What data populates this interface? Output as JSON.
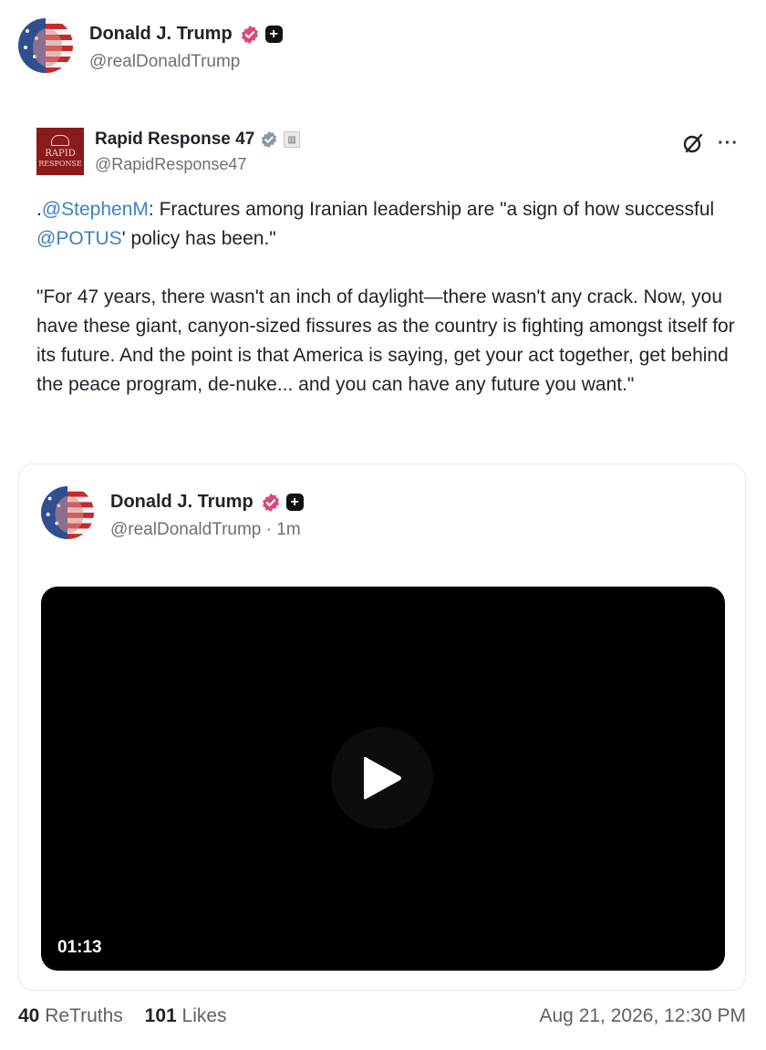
{
  "author": {
    "name": "Donald J. Trump",
    "handle": "@realDonaldTrump"
  },
  "retruth": {
    "name": "Rapid Response 47",
    "handle": "@RapidResponse47",
    "logo_text_1": "RAPID",
    "logo_text_2": "RESPONSE",
    "text_parts": {
      "p1_prefix": ".",
      "mention1": "@StephenM",
      "p1_mid": ": Fractures among Iranian leadership are \"a sign of how successful ",
      "mention2": "@POTUS",
      "p1_end": "' policy has been.\"",
      "p2": "\"For 47 years, there wasn't an inch of daylight—there wasn't any crack. Now, you have these giant, canyon-sized fissures as the country is fighting amongst itself for its future. And the point is that America is saying, get your act together, get behind the peace program, de-nuke... and you can have any future you want.\""
    }
  },
  "quote": {
    "name": "Donald J. Trump",
    "handle_time": "@realDonaldTrump · 1m",
    "video_duration": "01:13"
  },
  "footer": {
    "retruths_count": "40",
    "retruths_label": "ReTruths",
    "likes_count": "101",
    "likes_label": "Likes",
    "timestamp": "Aug 21, 2026, 12:30 PM"
  },
  "colors": {
    "mention": "#3b82c4",
    "verified_pink": "#e0457b",
    "verified_grey": "#8a96a3"
  }
}
